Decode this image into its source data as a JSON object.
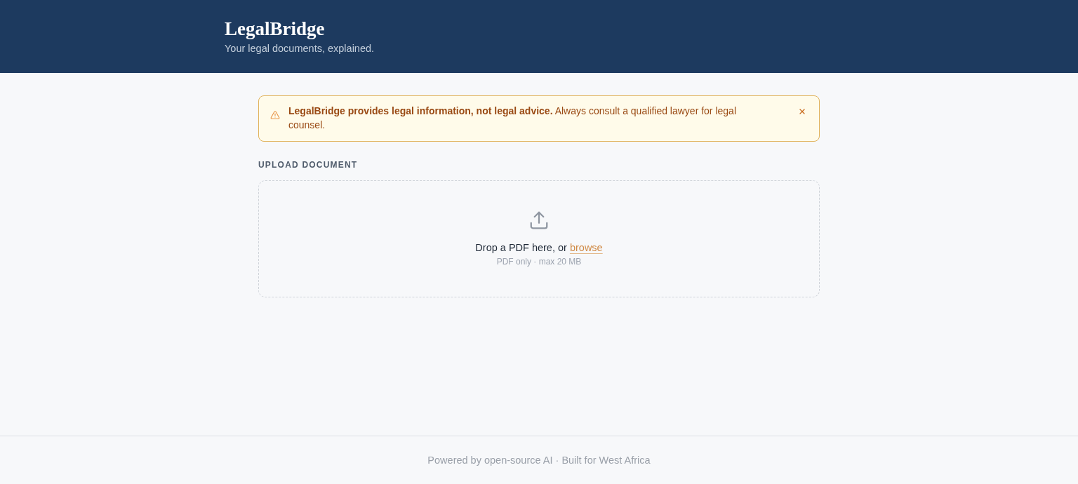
{
  "header": {
    "title": "LegalBridge",
    "tagline": "Your legal documents, explained."
  },
  "notice": {
    "text": "**LegalBridge provides legal information, not legal advice.** Always consult a qualified lawyer for legal counsel."
  },
  "upload": {
    "label": "UPLOAD DOCUMENT",
    "prompt": "Drop a PDF here, or",
    "link": "browse",
    "hint": "PDF only · max 20 MB"
  },
  "footer": {
    "text": "Powered by open-source AI · Built for West Africa"
  }
}
